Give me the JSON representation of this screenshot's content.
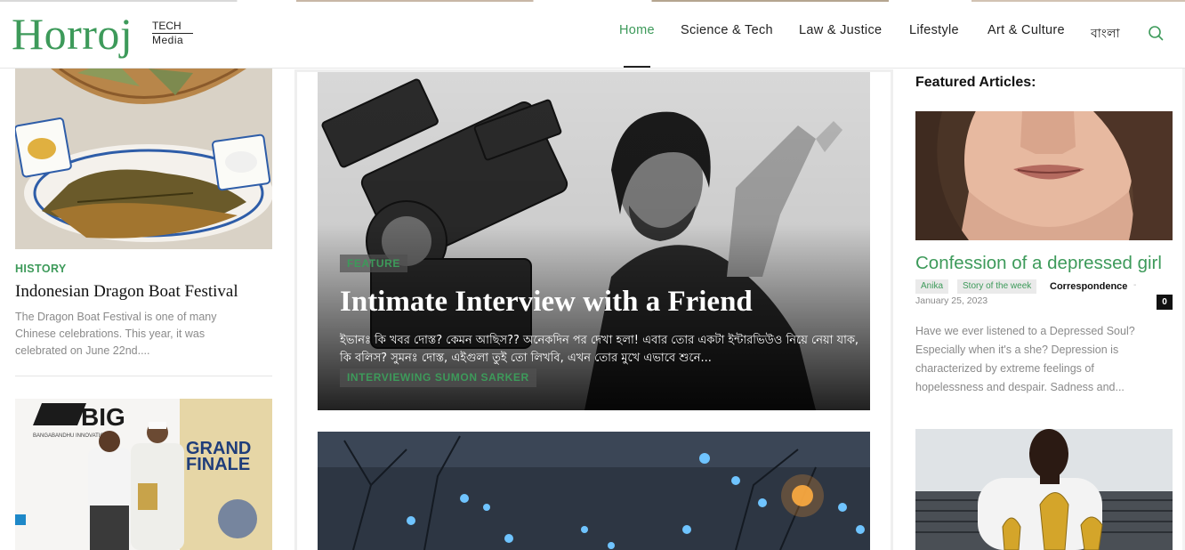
{
  "brand": {
    "name": "Horroj",
    "tech": "TECH",
    "media": "Media"
  },
  "nav": {
    "items": [
      {
        "label": "Home",
        "active": true
      },
      {
        "label": "Science & Tech"
      },
      {
        "label": "Law & Justice"
      },
      {
        "label": "Lifestyle"
      },
      {
        "label": "Art & Culture"
      },
      {
        "label": "বাংলা"
      }
    ],
    "search_icon": "search-icon"
  },
  "left": {
    "article1": {
      "category": "HISTORY",
      "title": "Indonesian Dragon Boat Festival",
      "excerpt": "The Dragon Boat Festival is one of many Chinese celebrations. This year, it was celebrated on June 22nd...."
    },
    "article2_image_text": {
      "big": "BIG",
      "grand": "GRAND",
      "finale": "FINALE",
      "sub": "BANGABANDHU INNOVATION"
    }
  },
  "hero": {
    "tag": "FEATURE",
    "title": "Intimate Interview with a Friend",
    "excerpt": "ইভানঃ কি খবর দোস্ত? কেমন আছিস?? অনেকদিন পর দেখা হলা! এবার তোর একটা ইন্টারভিউও নিয়ে নেয়া যাক, কি বলিস? সুমনঃ দোস্ত, এইগুলা তুই তো লিখবি, এখন তোর মুখে এভাবে শুনে...",
    "author": "INTERVIEWING SUMON SARKER"
  },
  "featured": {
    "heading": "Featured Articles:",
    "article1": {
      "title": "Confession of a depressed girl",
      "tags": [
        "Anika",
        "Story of the week"
      ],
      "category": "Correspondence",
      "date": "January 25, 2023",
      "comments": "0",
      "excerpt": "Have we ever listened to a Depressed Soul? Especially when it's a she? Depression is characterized by extreme feelings of hopelessness and despair. Sadness and..."
    }
  },
  "colors": {
    "accent": "#3d9a5a",
    "text": "#111111",
    "muted": "#8a8a8a"
  }
}
